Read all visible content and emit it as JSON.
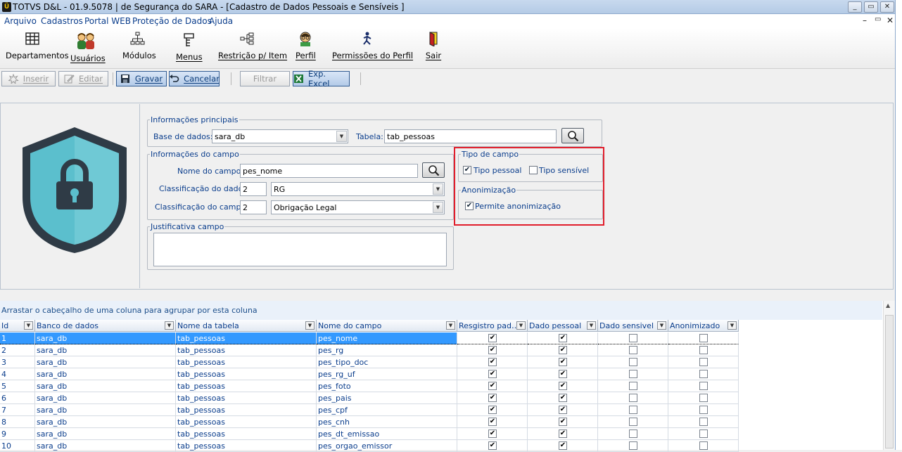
{
  "window": {
    "title": "TOTVS D&L - 01.9.5078 | de Segurança do SARA - [Cadastro de Dados Pessoais e Sensíveis ]",
    "controls": [
      "_",
      "▭",
      "✕"
    ]
  },
  "menu": {
    "items": [
      "Arquivo",
      "Cadastros",
      "Portal WEB",
      "Proteção de Dados",
      "Ajuda"
    ],
    "mdi_controls": [
      "–",
      "▭",
      "✕"
    ]
  },
  "toolbar": {
    "items": [
      {
        "label": "Departamentos",
        "icon": "grid-icon"
      },
      {
        "label": "Usuários",
        "icon": "users-icon"
      },
      {
        "label": "Módulos",
        "icon": "modules-icon"
      },
      {
        "label": "Menus",
        "icon": "menus-icon"
      },
      {
        "label": "Restrição p/ Item",
        "icon": "restriction-icon"
      },
      {
        "label": "Perfil",
        "icon": "profile-icon"
      },
      {
        "label": "Permissões do Perfil",
        "icon": "permissions-icon"
      },
      {
        "label": "Sair",
        "icon": "exit-icon"
      }
    ]
  },
  "actions": {
    "inserir": "Inserir",
    "editar": "Editar",
    "gravar": "Gravar",
    "cancelar": "Cancelar",
    "filtrar": "Filtrar",
    "exp_excel": "Exp. Excel"
  },
  "form": {
    "principal": {
      "legend": "Informações principais",
      "base_label": "Base de dados:",
      "base_value": "sara_db",
      "tabela_label": "Tabela:",
      "tabela_value": "tab_pessoas"
    },
    "campo": {
      "legend": "Informações do campo",
      "nome_label": "Nome do campo:",
      "nome_value": "pes_nome",
      "class_dado_label": "Classificação do dado:",
      "class_dado_code": "2",
      "class_dado_value": "RG",
      "class_campo_label": "Classificação do campo:",
      "class_campo_code": "2",
      "class_campo_value": "Obrigação Legal"
    },
    "justificativa": {
      "legend": "Justificativa campo",
      "value": ""
    },
    "tipo": {
      "legend": "Tipo de campo",
      "pessoal_label": "Tipo pessoal",
      "pessoal_checked": true,
      "sensivel_label": "Tipo sensível",
      "sensivel_checked": false
    },
    "anon": {
      "legend": "Anonimização",
      "permite_label": "Permite anonimização",
      "permite_checked": true
    }
  },
  "grid": {
    "group_hint": "Arrastar o cabeçalho de uma coluna para agrupar por esta coluna",
    "columns": [
      "Id",
      "Banco de dados",
      "Nome da tabela",
      "Nome do campo",
      "Resgistro pad…",
      "Dado pessoal",
      "Dado sensivel",
      "Anonimizado"
    ],
    "rows": [
      {
        "id": "1",
        "banco": "sara_db",
        "tabela": "tab_pessoas",
        "campo": "pes_nome",
        "registro": true,
        "pessoal": true,
        "sensivel": false,
        "anon": false
      },
      {
        "id": "2",
        "banco": "sara_db",
        "tabela": "tab_pessoas",
        "campo": "pes_rg",
        "registro": true,
        "pessoal": true,
        "sensivel": false,
        "anon": false
      },
      {
        "id": "3",
        "banco": "sara_db",
        "tabela": "tab_pessoas",
        "campo": "pes_tipo_doc",
        "registro": true,
        "pessoal": true,
        "sensivel": false,
        "anon": false
      },
      {
        "id": "4",
        "banco": "sara_db",
        "tabela": "tab_pessoas",
        "campo": "pes_rg_uf",
        "registro": true,
        "pessoal": true,
        "sensivel": false,
        "anon": false
      },
      {
        "id": "5",
        "banco": "sara_db",
        "tabela": "tab_pessoas",
        "campo": "pes_foto",
        "registro": true,
        "pessoal": true,
        "sensivel": false,
        "anon": false
      },
      {
        "id": "6",
        "banco": "sara_db",
        "tabela": "tab_pessoas",
        "campo": "pes_pais",
        "registro": true,
        "pessoal": true,
        "sensivel": false,
        "anon": false
      },
      {
        "id": "7",
        "banco": "sara_db",
        "tabela": "tab_pessoas",
        "campo": "pes_cpf",
        "registro": true,
        "pessoal": true,
        "sensivel": false,
        "anon": false
      },
      {
        "id": "8",
        "banco": "sara_db",
        "tabela": "tab_pessoas",
        "campo": "pes_cnh",
        "registro": true,
        "pessoal": true,
        "sensivel": false,
        "anon": false
      },
      {
        "id": "9",
        "banco": "sara_db",
        "tabela": "tab_pessoas",
        "campo": "pes_dt_emissao",
        "registro": true,
        "pessoal": true,
        "sensivel": false,
        "anon": false
      },
      {
        "id": "10",
        "banco": "sara_db",
        "tabela": "tab_pessoas",
        "campo": "pes_orgao_emissor",
        "registro": true,
        "pessoal": true,
        "sensivel": false,
        "anon": false
      }
    ]
  },
  "colors": {
    "accent_text": "#0a3d8c",
    "highlight": "#e11d2b",
    "selected_row": "#3399ff",
    "shield_fill": "#5bbfcd",
    "shield_stroke": "#2f3b46"
  }
}
